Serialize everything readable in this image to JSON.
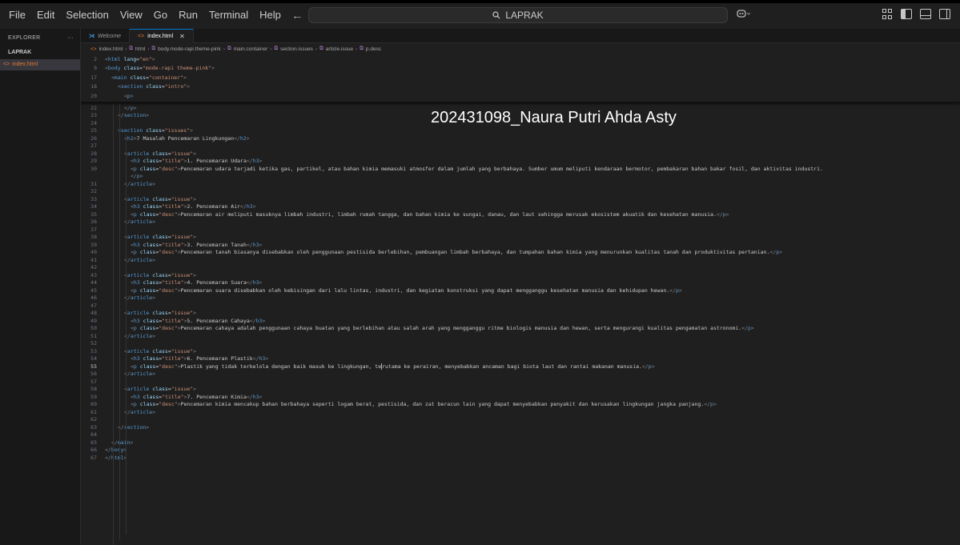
{
  "menu": [
    "File",
    "Edit",
    "Selection",
    "View",
    "Go",
    "Run",
    "Terminal",
    "Help"
  ],
  "nav": {
    "back": "←",
    "forward": "→"
  },
  "search": {
    "text": "LAPRAK"
  },
  "sidebar": {
    "title": "EXPLORER",
    "more": "···",
    "folder": "LAPRAK",
    "file": "index.html"
  },
  "tabs": [
    {
      "label": "Welcome",
      "active": false
    },
    {
      "label": "index.html",
      "active": true
    }
  ],
  "breadcrumb": [
    "index.html",
    "html",
    "body.mode-rapi.theme-pink",
    "main.container",
    "section.issues",
    "article.issue",
    "p.desc"
  ],
  "overlay_text": "202431098_Naura Putri Ahda Asty",
  "sticky_lines": [
    {
      "n": "2",
      "indent": 0,
      "html": "<span class='br'>&lt;</span><span class='tg'>html</span> <span class='at'>lang</span>=<span class='st'>\"en\"</span><span class='br'>&gt;</span>"
    },
    {
      "n": "9",
      "indent": 0,
      "html": "<span class='br'>&lt;</span><span class='tg'>body</span> <span class='at'>class</span>=<span class='st'>\"mode-rapi theme-pink\"</span><span class='br'>&gt;</span>"
    },
    {
      "n": "17",
      "indent": 1,
      "html": "<span class='br'>&lt;</span><span class='tg'>main</span> <span class='at'>class</span>=<span class='st'>\"container\"</span><span class='br'>&gt;</span>"
    },
    {
      "n": "18",
      "indent": 2,
      "html": "<span class='br'>&lt;</span><span class='tg'>section</span> <span class='at'>class</span>=<span class='st'>\"intro\"</span><span class='br'>&gt;</span>"
    },
    {
      "n": "20",
      "indent": 3,
      "html": "<span class='br'>&lt;</span><span class='tg'>p</span><span class='br'>&gt;</span>"
    }
  ],
  "lines": [
    {
      "n": "22",
      "indent": 3,
      "html": "<span class='br'>&lt;/</span><span class='tg'>p</span><span class='br'>&gt;</span>"
    },
    {
      "n": "23",
      "indent": 2,
      "html": "<span class='br'>&lt;/</span><span class='tg'>section</span><span class='br'>&gt;</span>"
    },
    {
      "n": "24",
      "indent": 0,
      "html": ""
    },
    {
      "n": "25",
      "indent": 2,
      "html": "<span class='br'>&lt;</span><span class='tg'>section</span> <span class='at'>class</span>=<span class='st'>\"issues\"</span><span class='br'>&gt;</span>"
    },
    {
      "n": "26",
      "indent": 3,
      "html": "<span class='br'>&lt;</span><span class='tg'>h2</span><span class='br'>&gt;</span>7 Masalah Pencemaran Lingkungan<span class='br'>&lt;/</span><span class='tg'>h2</span><span class='br'>&gt;</span>"
    },
    {
      "n": "27",
      "indent": 0,
      "html": ""
    },
    {
      "n": "28",
      "indent": 3,
      "html": "<span class='br'>&lt;</span><span class='tg'>article</span> <span class='at'>class</span>=<span class='st'>\"issue\"</span><span class='br'>&gt;</span>"
    },
    {
      "n": "29",
      "indent": 4,
      "html": "<span class='br'>&lt;</span><span class='tg'>h3</span> <span class='at'>class</span>=<span class='st'>\"title\"</span><span class='br'>&gt;</span>1. Pencemaran Udara<span class='br'>&lt;/</span><span class='tg'>h3</span><span class='br'>&gt;</span>"
    },
    {
      "n": "30",
      "indent": 4,
      "html": "<span class='br'>&lt;</span><span class='tg'>p</span> <span class='at'>class</span>=<span class='st'>\"desc\"</span><span class='br'>&gt;</span>Pencemaran udara terjadi ketika gas, partikel, atau bahan kimia memasuki atmosfer dalam jumlah yang berbahaya. Sumber umum meliputi kendaraan bermotor, pembakaran bahan bakar fosil, dan aktivitas industri."
    },
    {
      "n": "",
      "indent": 4,
      "html": "<span class='br'>&lt;/</span><span class='tg'>p</span><span class='br'>&gt;</span>"
    },
    {
      "n": "31",
      "indent": 3,
      "html": "<span class='br'>&lt;/</span><span class='tg'>article</span><span class='br'>&gt;</span>"
    },
    {
      "n": "32",
      "indent": 0,
      "html": ""
    },
    {
      "n": "33",
      "indent": 3,
      "html": "<span class='br'>&lt;</span><span class='tg'>article</span> <span class='at'>class</span>=<span class='st'>\"issue\"</span><span class='br'>&gt;</span>"
    },
    {
      "n": "34",
      "indent": 4,
      "html": "<span class='br'>&lt;</span><span class='tg'>h3</span> <span class='at'>class</span>=<span class='st'>\"title\"</span><span class='br'>&gt;</span>2. Pencemaran Air<span class='br'>&lt;/</span><span class='tg'>h3</span><span class='br'>&gt;</span>"
    },
    {
      "n": "35",
      "indent": 4,
      "html": "<span class='br'>&lt;</span><span class='tg'>p</span> <span class='at'>class</span>=<span class='st'>\"desc\"</span><span class='br'>&gt;</span>Pencemaran air meliputi masuknya limbah industri, limbah rumah tangga, dan bahan kimia ke sungai, danau, dan laut sehingga merusak ekosistem akuatik dan kesehatan manusia.<span class='br'>&lt;/</span><span class='tg'>p</span><span class='br'>&gt;</span>"
    },
    {
      "n": "36",
      "indent": 3,
      "html": "<span class='br'>&lt;/</span><span class='tg'>article</span><span class='br'>&gt;</span>"
    },
    {
      "n": "37",
      "indent": 0,
      "html": ""
    },
    {
      "n": "38",
      "indent": 3,
      "html": "<span class='br'>&lt;</span><span class='tg'>article</span> <span class='at'>class</span>=<span class='st'>\"issue\"</span><span class='br'>&gt;</span>"
    },
    {
      "n": "39",
      "indent": 4,
      "html": "<span class='br'>&lt;</span><span class='tg'>h3</span> <span class='at'>class</span>=<span class='st'>\"title\"</span><span class='br'>&gt;</span>3. Pencemaran Tanah<span class='br'>&lt;/</span><span class='tg'>h3</span><span class='br'>&gt;</span>"
    },
    {
      "n": "40",
      "indent": 4,
      "html": "<span class='br'>&lt;</span><span class='tg'>p</span> <span class='at'>class</span>=<span class='st'>\"desc\"</span><span class='br'>&gt;</span>Pencemaran tanah biasanya disebabkan oleh penggunaan pestisida berlebihan, pembuangan limbah berbahaya, dan tumpahan bahan kimia yang menurunkan kualitas tanah dan produktivitas pertanian.<span class='br'>&lt;/</span><span class='tg'>p</span><span class='br'>&gt;</span>"
    },
    {
      "n": "41",
      "indent": 3,
      "html": "<span class='br'>&lt;/</span><span class='tg'>article</span><span class='br'>&gt;</span>"
    },
    {
      "n": "42",
      "indent": 0,
      "html": ""
    },
    {
      "n": "43",
      "indent": 3,
      "html": "<span class='br'>&lt;</span><span class='tg'>article</span> <span class='at'>class</span>=<span class='st'>\"issue\"</span><span class='br'>&gt;</span>"
    },
    {
      "n": "44",
      "indent": 4,
      "html": "<span class='br'>&lt;</span><span class='tg'>h3</span> <span class='at'>class</span>=<span class='st'>\"title\"</span><span class='br'>&gt;</span>4. Pencemaran Suara<span class='br'>&lt;/</span><span class='tg'>h3</span><span class='br'>&gt;</span>"
    },
    {
      "n": "45",
      "indent": 4,
      "html": "<span class='br'>&lt;</span><span class='tg'>p</span> <span class='at'>class</span>=<span class='st'>\"desc\"</span><span class='br'>&gt;</span>Pencemaran suara disebabkan oleh kebisingan dari lalu lintas, industri, dan kegiatan konstruksi yang dapat mengganggu kesehatan manusia dan kehidupan hewan.<span class='br'>&lt;/</span><span class='tg'>p</span><span class='br'>&gt;</span>"
    },
    {
      "n": "46",
      "indent": 3,
      "html": "<span class='br'>&lt;/</span><span class='tg'>article</span><span class='br'>&gt;</span>"
    },
    {
      "n": "47",
      "indent": 0,
      "html": ""
    },
    {
      "n": "48",
      "indent": 3,
      "html": "<span class='br'>&lt;</span><span class='tg'>article</span> <span class='at'>class</span>=<span class='st'>\"issue\"</span><span class='br'>&gt;</span>"
    },
    {
      "n": "49",
      "indent": 4,
      "html": "<span class='br'>&lt;</span><span class='tg'>h3</span> <span class='at'>class</span>=<span class='st'>\"title\"</span><span class='br'>&gt;</span>5. Pencemaran Cahaya<span class='br'>&lt;/</span><span class='tg'>h3</span><span class='br'>&gt;</span>"
    },
    {
      "n": "50",
      "indent": 4,
      "html": "<span class='br'>&lt;</span><span class='tg'>p</span> <span class='at'>class</span>=<span class='st'>\"desc\"</span><span class='br'>&gt;</span>Pencemaran cahaya adalah penggunaan cahaya buatan yang berlebihan atau salah arah yang mengganggu ritme biologis manusia dan hewan, serta mengurangi kualitas pengamatan astronomi.<span class='br'>&lt;/</span><span class='tg'>p</span><span class='br'>&gt;</span>"
    },
    {
      "n": "51",
      "indent": 3,
      "html": "<span class='br'>&lt;/</span><span class='tg'>article</span><span class='br'>&gt;</span>"
    },
    {
      "n": "52",
      "indent": 0,
      "html": ""
    },
    {
      "n": "53",
      "indent": 3,
      "html": "<span class='br'>&lt;</span><span class='tg'>article</span> <span class='at'>class</span>=<span class='st'>\"issue\"</span><span class='br'>&gt;</span>"
    },
    {
      "n": "54",
      "indent": 4,
      "html": "<span class='br'>&lt;</span><span class='tg'>h3</span> <span class='at'>class</span>=<span class='st'>\"title\"</span><span class='br'>&gt;</span>6. Pencemaran Plastik<span class='br'>&lt;/</span><span class='tg'>h3</span><span class='br'>&gt;</span>"
    },
    {
      "n": "55",
      "indent": 4,
      "cur": true,
      "html": "<span class='br'>&lt;</span><span class='tg'>p</span> <span class='at'>class</span>=<span class='st'>\"desc\"</span><span class='br'>&gt;</span>Plastik yang tidak terkelola dengan baik masuk ke lingkungan, te<span class='cursor'></span>rutama ke perairan, menyebabkan ancaman bagi biota laut dan rantai makanan manusia.<span class='br'>&lt;/</span><span class='tg'>p</span><span class='br'>&gt;</span>"
    },
    {
      "n": "56",
      "indent": 3,
      "html": "<span class='br'>&lt;/</span><span class='tg'>article</span><span class='br'>&gt;</span>"
    },
    {
      "n": "57",
      "indent": 0,
      "html": ""
    },
    {
      "n": "58",
      "indent": 3,
      "html": "<span class='br'>&lt;</span><span class='tg'>article</span> <span class='at'>class</span>=<span class='st'>\"issue\"</span><span class='br'>&gt;</span>"
    },
    {
      "n": "59",
      "indent": 4,
      "html": "<span class='br'>&lt;</span><span class='tg'>h3</span> <span class='at'>class</span>=<span class='st'>\"title\"</span><span class='br'>&gt;</span>7. Pencemaran Kimia<span class='br'>&lt;/</span><span class='tg'>h3</span><span class='br'>&gt;</span>"
    },
    {
      "n": "60",
      "indent": 4,
      "html": "<span class='br'>&lt;</span><span class='tg'>p</span> <span class='at'>class</span>=<span class='st'>\"desc\"</span><span class='br'>&gt;</span>Pencemaran kimia mencakup bahan berbahaya seperti logam berat, pestisida, dan zat beracun lain yang dapat menyebabkan penyakit dan kerusakan lingkungan jangka panjang.<span class='br'>&lt;/</span><span class='tg'>p</span><span class='br'>&gt;</span>"
    },
    {
      "n": "61",
      "indent": 3,
      "html": "<span class='br'>&lt;/</span><span class='tg'>article</span><span class='br'>&gt;</span>"
    },
    {
      "n": "62",
      "indent": 0,
      "html": ""
    },
    {
      "n": "63",
      "indent": 2,
      "html": "<span class='br'>&lt;/</span><span class='tg'>section</span><span class='br'>&gt;</span>"
    },
    {
      "n": "64",
      "indent": 0,
      "html": ""
    },
    {
      "n": "65",
      "indent": 1,
      "html": "<span class='br'>&lt;/</span><span class='tg'>main</span><span class='br'>&gt;</span>"
    },
    {
      "n": "66",
      "indent": 0,
      "html": "<span class='br'>&lt;/</span><span class='tg'>body</span><span class='br'>&gt;</span>"
    },
    {
      "n": "67",
      "indent": 0,
      "html": "<span class='br'>&lt;/</span><span class='tg'>html</span><span class='br'>&gt;</span>"
    }
  ]
}
